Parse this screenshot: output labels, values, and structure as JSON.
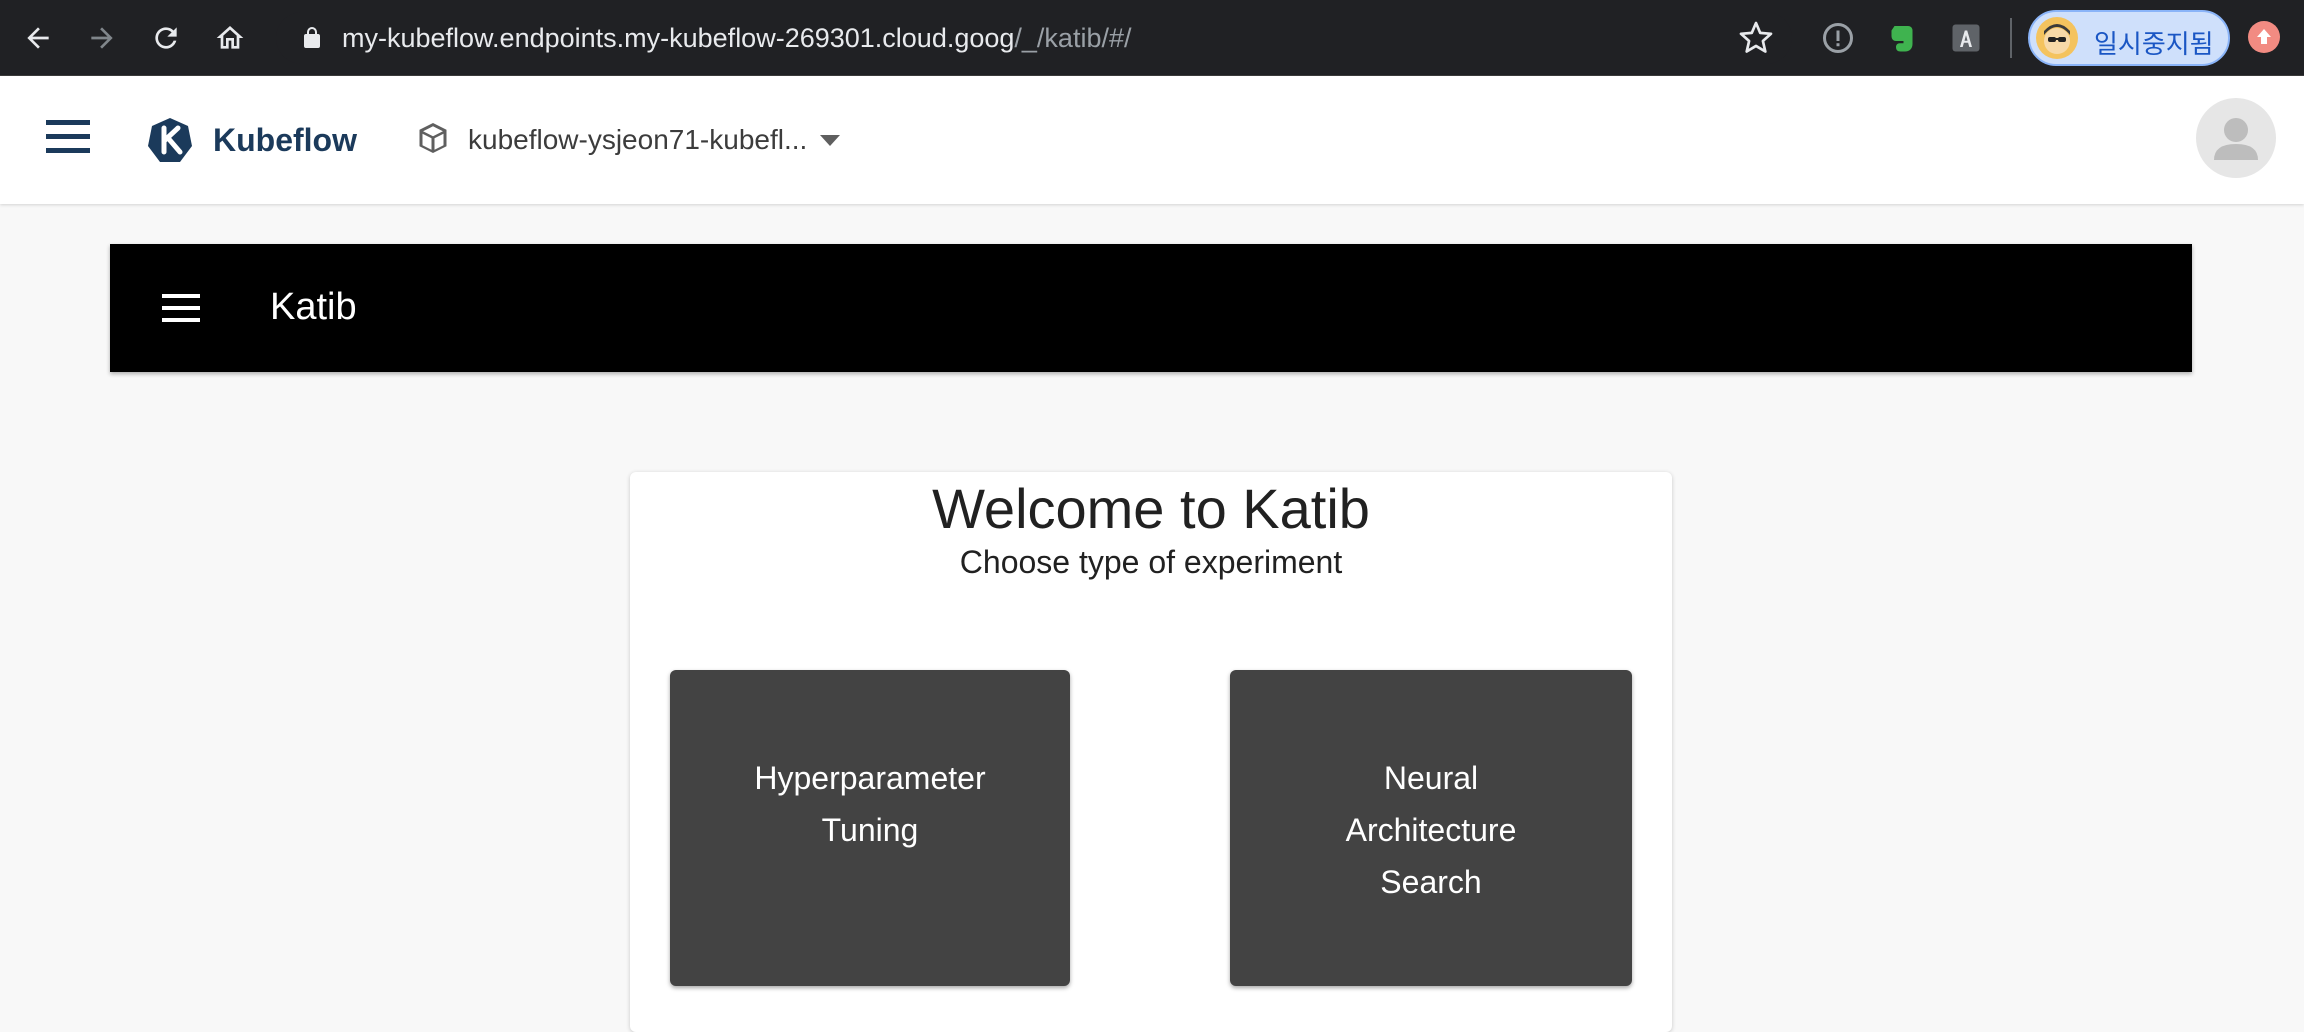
{
  "browser": {
    "url_host": "my-kubeflow.endpoints.my-kubeflow-269301.cloud.goog",
    "url_path": "/_/katib/#/",
    "profile_label": "일시중지됨"
  },
  "header": {
    "app_title": "Kubeflow",
    "namespace": "kubeflow-ysjeon71-kubefl..."
  },
  "toolbar": {
    "title": "Katib"
  },
  "welcome": {
    "title": "Welcome to Katib",
    "subtitle": "Choose type of experiment",
    "options": [
      {
        "lines": [
          "Hyperparameter",
          "Tuning"
        ]
      },
      {
        "lines": [
          "Neural",
          "Architecture",
          "Search"
        ]
      }
    ]
  },
  "colors": {
    "browser_bg": "#202124",
    "kubeflow_brand": "#1b3a5b",
    "katib_bar": "#000000",
    "choice_bg": "#434343",
    "page_bg": "#f8f8f8"
  }
}
